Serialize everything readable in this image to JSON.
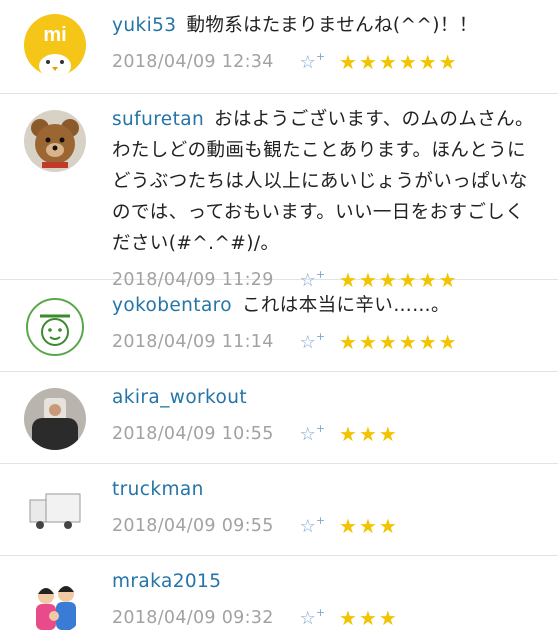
{
  "comments": [
    {
      "user": "yuki53",
      "text": "動物系はたまりませんね(^^)！！",
      "time": "2018/04/09 12:34",
      "stars": "★★★★★★"
    },
    {
      "user": "sufuretan",
      "text": "おはようございます、のムのムさん。わたしどの動画も観たことあります。ほんとうにどうぶつたちは人以上にあいじょうがいっぱいなのでは、っておもいます。いい一日をおすごしください(#^.^#)/。",
      "time": "2018/04/09 11:29",
      "stars": "★★★★★★"
    },
    {
      "user": "yokobentaro",
      "text": "これは本当に辛い……。",
      "time": "2018/04/09 11:14",
      "stars": "★★★★★★"
    },
    {
      "user": "akira_workout",
      "text": "",
      "time": "2018/04/09 10:55",
      "stars": "★★★"
    },
    {
      "user": "truckman",
      "text": "",
      "time": "2018/04/09 09:55",
      "stars": "★★★"
    },
    {
      "user": "mraka2015",
      "text": "",
      "time": "2018/04/09 09:32",
      "stars": "★★★"
    }
  ],
  "avatar_logo_text": "mi",
  "star_add_glyph": "☆",
  "star_add_plus": "+"
}
